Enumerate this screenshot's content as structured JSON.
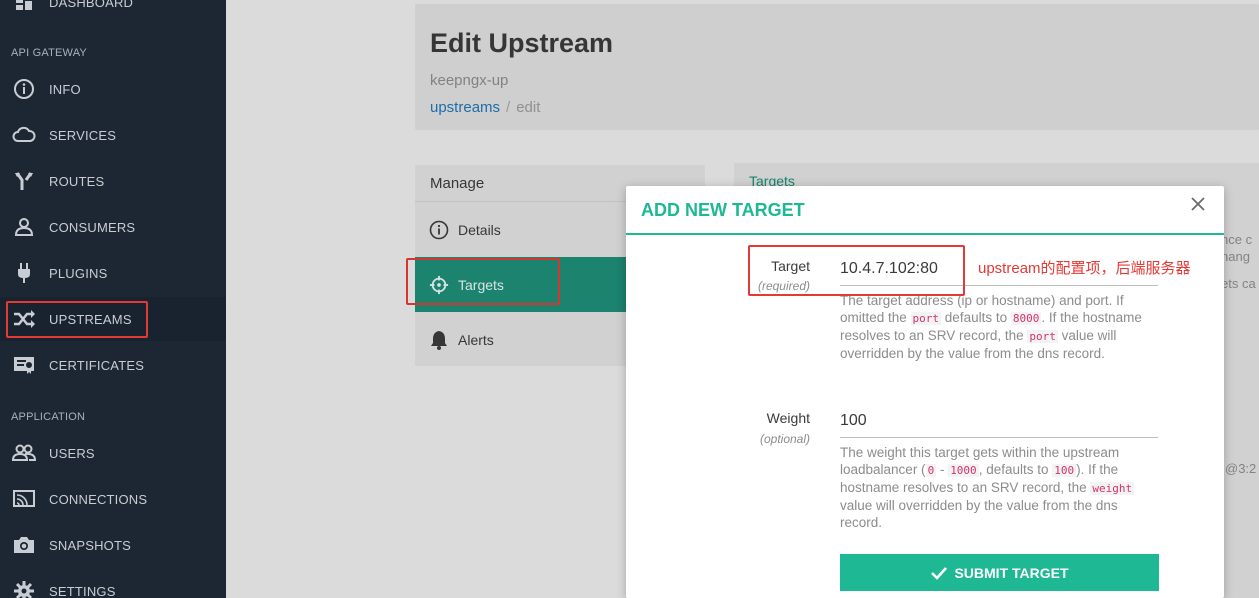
{
  "sidebar": {
    "top_item": "DASHBOARD",
    "section_api": "API GATEWAY",
    "items_api": [
      {
        "label": "INFO",
        "icon": "info-icon"
      },
      {
        "label": "SERVICES",
        "icon": "cloud-icon"
      },
      {
        "label": "ROUTES",
        "icon": "routes-icon"
      },
      {
        "label": "CONSUMERS",
        "icon": "user-icon"
      },
      {
        "label": "PLUGINS",
        "icon": "plug-icon"
      },
      {
        "label": "UPSTREAMS",
        "icon": "shuffle-icon"
      },
      {
        "label": "CERTIFICATES",
        "icon": "certificate-icon"
      }
    ],
    "section_app": "APPLICATION",
    "items_app": [
      {
        "label": "USERS",
        "icon": "users-icon"
      },
      {
        "label": "CONNECTIONS",
        "icon": "connections-icon"
      },
      {
        "label": "SNAPSHOTS",
        "icon": "camera-icon"
      },
      {
        "label": "SETTINGS",
        "icon": "gear-icon"
      }
    ]
  },
  "header": {
    "title": "Edit Upstream",
    "subtitle": "keepngx-up",
    "breadcrumb_link": "upstreams",
    "breadcrumb_sep": "/",
    "breadcrumb_current": "edit"
  },
  "manage": {
    "heading": "Manage",
    "items": [
      {
        "label": "Details",
        "icon": "info-icon"
      },
      {
        "label": "Targets",
        "icon": "crosshair-icon"
      },
      {
        "label": "Alerts",
        "icon": "bell-icon"
      }
    ]
  },
  "targets_panel": {
    "tab": "Targets",
    "fragments": [
      "nce c",
      "hang",
      "ets ca",
      "@3:2"
    ]
  },
  "modal": {
    "title": "ADD NEW TARGET",
    "target_label": "Target",
    "target_note": "(required)",
    "target_value": "10.4.7.102:80",
    "target_help": {
      "p1": "The target address (ip or hostname) and port. If omitted the ",
      "c1": "port",
      "p2": " defaults to ",
      "c2": "8000",
      "p3": ". If the hostname resolves to an SRV record, the ",
      "c3": "port",
      "p4": " value will overridden by the value from the dns record."
    },
    "weight_label": "Weight",
    "weight_note": "(optional)",
    "weight_value": "100",
    "weight_help": {
      "p1": "The weight this target gets within the upstream loadbalancer (",
      "c1": "0",
      "p2": " - ",
      "c2": "1000",
      "p3": ", defaults to ",
      "c3": "100",
      "p4": "). If the hostname resolves to an SRV record, the ",
      "c4": "weight",
      "p5": " value will overridden by the value from the dns record."
    },
    "submit_label": "SUBMIT TARGET"
  },
  "annotation": "upstream的配置项，后端服务器",
  "colors": {
    "sidebar_bg": "#1c2733",
    "accent": "#1eb894",
    "active_tab": "#1d8c75",
    "highlight": "#e53935"
  }
}
